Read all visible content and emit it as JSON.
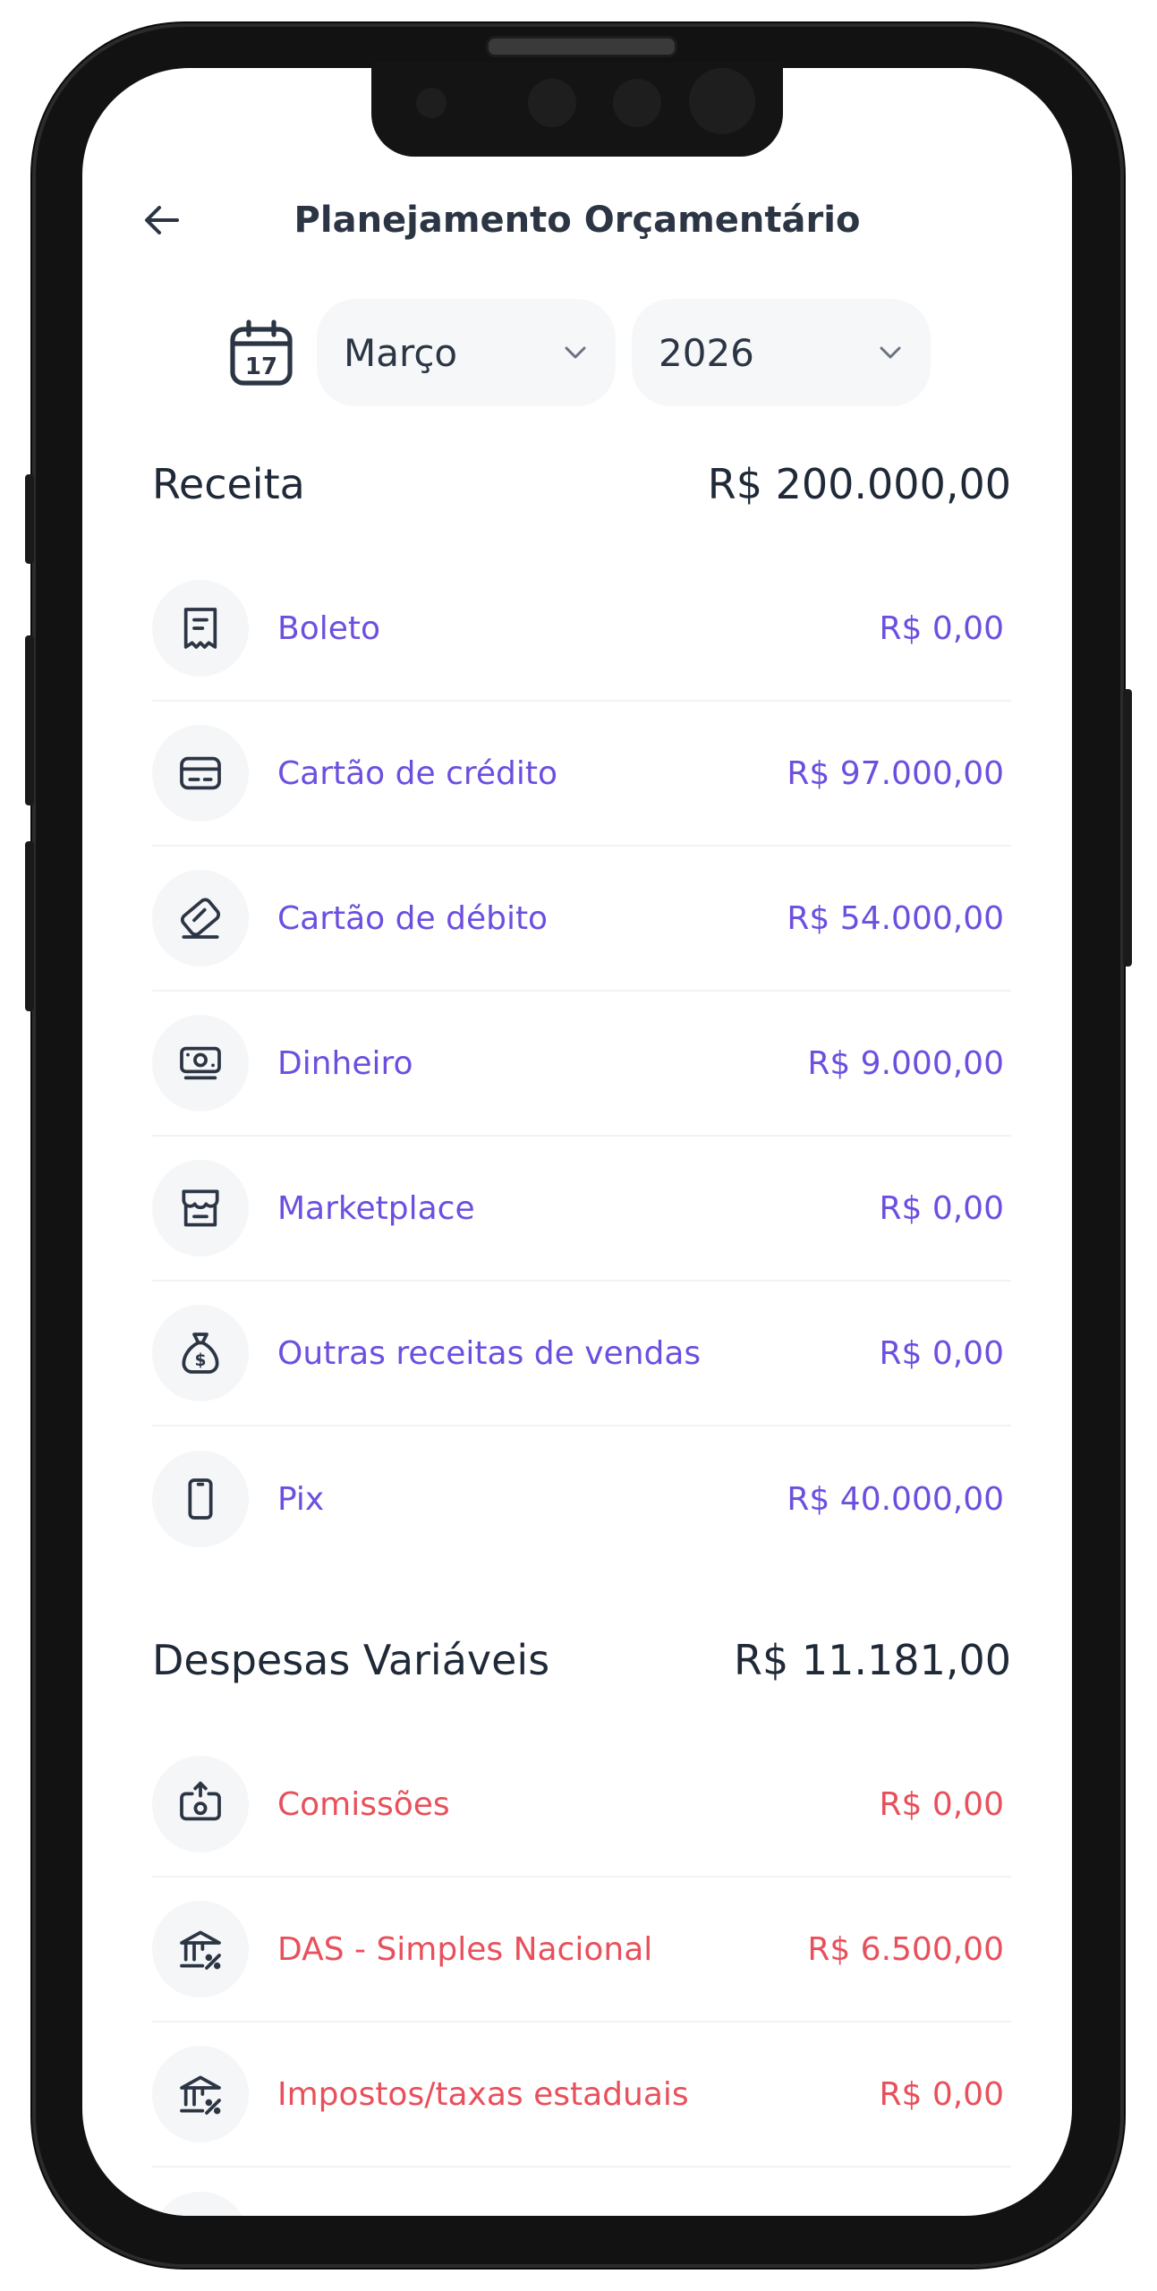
{
  "header": {
    "title": "Planejamento Orçamentário"
  },
  "filters": {
    "month": "Março",
    "year": "2026"
  },
  "income": {
    "label": "Receita",
    "total": "R$ 200.000,00",
    "items": [
      {
        "name": "Boleto",
        "value": "R$ 0,00",
        "icon": "receipt-icon"
      },
      {
        "name": "Cartão de crédito",
        "value": "R$ 97.000,00",
        "icon": "credit-card-icon"
      },
      {
        "name": "Cartão de débito",
        "value": "R$ 54.000,00",
        "icon": "debit-card-icon"
      },
      {
        "name": "Dinheiro",
        "value": "R$ 9.000,00",
        "icon": "cash-icon"
      },
      {
        "name": "Marketplace",
        "value": "R$ 0,00",
        "icon": "store-icon"
      },
      {
        "name": "Outras receitas de vendas",
        "value": "R$ 0,00",
        "icon": "money-bag-icon"
      },
      {
        "name": "Pix",
        "value": "R$ 40.000,00",
        "icon": "smartphone-icon"
      }
    ]
  },
  "expenses": {
    "label": "Despesas Variáveis",
    "total": "R$ 11.181,00",
    "items": [
      {
        "name": "Comissões",
        "value": "R$ 0,00",
        "icon": "cash-out-icon"
      },
      {
        "name": "DAS - Simples Nacional",
        "value": "R$ 6.500,00",
        "icon": "bank-percent-icon"
      },
      {
        "name": "Impostos/taxas estaduais",
        "value": "R$ 0,00",
        "icon": "bank-percent-icon"
      }
    ]
  },
  "colors": {
    "income": "#6d4fe0",
    "expense": "#e8505b",
    "text": "#1f2937"
  }
}
